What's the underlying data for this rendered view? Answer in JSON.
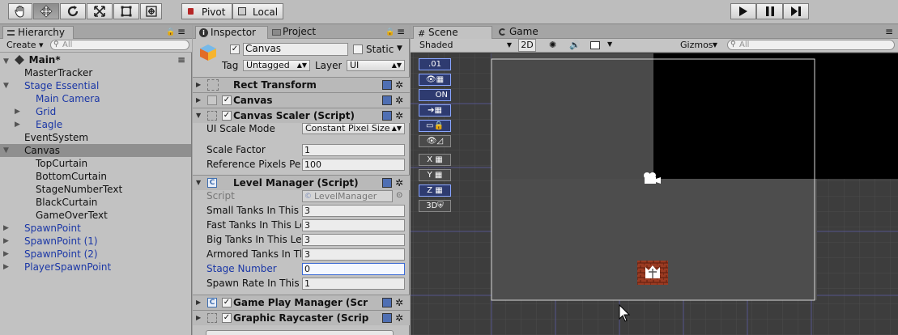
{
  "toolbar": {
    "tools": [
      {
        "name": "hand-tool-icon"
      },
      {
        "name": "move-tool-icon"
      },
      {
        "name": "rotate-tool-icon"
      },
      {
        "name": "scale-tool-icon"
      },
      {
        "name": "rect-tool-icon"
      },
      {
        "name": "transform-tool-icon"
      }
    ],
    "pivot_label": "Pivot",
    "local_label": "Local",
    "play_icon": "play-icon",
    "pause_icon": "pause-icon",
    "step_icon": "step-icon"
  },
  "hierarchy": {
    "tab_label": "Hierarchy",
    "create_label": "Create",
    "search_placeholder": "All",
    "scene_name": "Main*",
    "items": [
      {
        "label": "MasterTracker",
        "indent": 1,
        "blue": false,
        "arrow": ""
      },
      {
        "label": "Stage Essential",
        "indent": 1,
        "blue": true,
        "arrow": "▼"
      },
      {
        "label": "Main Camera",
        "indent": 2,
        "blue": true,
        "arrow": ""
      },
      {
        "label": "Grid",
        "indent": 2,
        "blue": true,
        "arrow": "▶"
      },
      {
        "label": "Eagle",
        "indent": 2,
        "blue": true,
        "arrow": "▶"
      },
      {
        "label": "EventSystem",
        "indent": 1,
        "blue": false,
        "arrow": ""
      },
      {
        "label": "Canvas",
        "indent": 1,
        "blue": false,
        "arrow": "▼",
        "selected": true
      },
      {
        "label": "TopCurtain",
        "indent": 2,
        "blue": false,
        "arrow": ""
      },
      {
        "label": "BottomCurtain",
        "indent": 2,
        "blue": false,
        "arrow": ""
      },
      {
        "label": "StageNumberText",
        "indent": 2,
        "blue": false,
        "arrow": ""
      },
      {
        "label": "BlackCurtain",
        "indent": 2,
        "blue": false,
        "arrow": ""
      },
      {
        "label": "GameOverText",
        "indent": 2,
        "blue": false,
        "arrow": ""
      },
      {
        "label": "SpawnPoint",
        "indent": 1,
        "blue": true,
        "arrow": "▶"
      },
      {
        "label": "SpawnPoint (1)",
        "indent": 1,
        "blue": true,
        "arrow": "▶"
      },
      {
        "label": "SpawnPoint (2)",
        "indent": 1,
        "blue": true,
        "arrow": "▶"
      },
      {
        "label": "PlayerSpawnPoint",
        "indent": 1,
        "blue": true,
        "arrow": "▶"
      }
    ]
  },
  "inspector": {
    "tab_label": "Inspector",
    "project_tab_label": "Project",
    "object_name": "Canvas",
    "static_label": "Static",
    "tag_label": "Tag",
    "tag_value": "Untagged",
    "layer_label": "Layer",
    "layer_value": "UI",
    "components": {
      "rect_transform": "Rect Transform",
      "canvas": "Canvas",
      "canvas_scaler": "Canvas Scaler (Script)",
      "level_manager": "Level Manager (Script)",
      "game_play_manager": "Game Play Manager (Scr",
      "graphic_raycaster": "Graphic Raycaster (Scrip"
    },
    "canvas_scaler": {
      "ui_scale_mode_label": "UI Scale Mode",
      "ui_scale_mode_value": "Constant Pixel Size",
      "scale_factor_label": "Scale Factor",
      "scale_factor_value": "1",
      "ref_ppu_label": "Reference Pixels Per",
      "ref_ppu_value": "100"
    },
    "level_manager": {
      "script_label": "Script",
      "script_value": "LevelManager",
      "fields": [
        {
          "label": "Small Tanks In This",
          "value": "3"
        },
        {
          "label": "Fast Tanks In This Le",
          "value": "3"
        },
        {
          "label": "Big Tanks In This Le",
          "value": "3"
        },
        {
          "label": "Armored Tanks In Tl",
          "value": "3"
        },
        {
          "label": "Stage Number",
          "value": "0"
        },
        {
          "label": "Spawn Rate In This I",
          "value": "1"
        }
      ]
    }
  },
  "scene": {
    "scene_tab_label": "Scene",
    "game_tab_label": "Game",
    "shading_value": "Shaded",
    "mode_2d_label": "2D",
    "gizmos_label": "Gizmos",
    "search_placeholder": "All",
    "overlay_buttons": [
      ".01",
      "",
      "ON",
      "",
      "",
      "",
      "X",
      "Y",
      "Z",
      "3D"
    ]
  }
}
